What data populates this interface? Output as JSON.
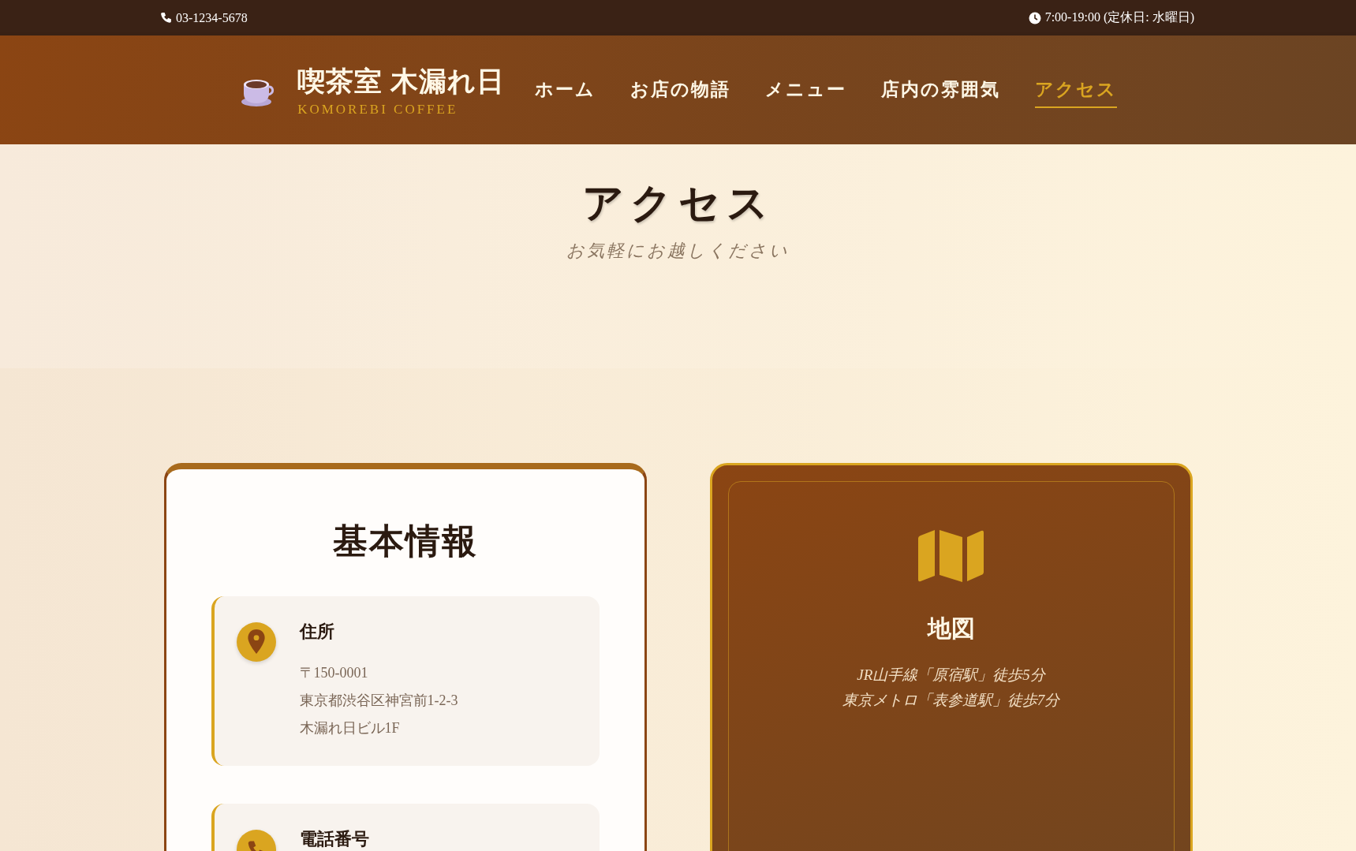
{
  "top_bar": {
    "phone": "03-1234-5678",
    "hours": "7:00-19:00 (定休日: 水曜日)"
  },
  "header": {
    "logo_title": "喫茶室 木漏れ日",
    "logo_subtitle": "KOMOREBI COFFEE",
    "nav": [
      {
        "label": "ホーム",
        "selected": false
      },
      {
        "label": "お店の物語",
        "selected": false
      },
      {
        "label": "メニュー",
        "selected": false
      },
      {
        "label": "店内の雰囲気",
        "selected": false
      },
      {
        "label": "アクセス",
        "selected": true
      }
    ]
  },
  "hero": {
    "title": "アクセス",
    "subtitle": "お気軽にお越しください"
  },
  "info_card": {
    "title": "基本情報",
    "items": [
      {
        "kind": "address",
        "label": "住所",
        "lines": [
          "〒150-0001",
          "東京都渋谷区神宮前1-2-3",
          "木漏れ日ビル1F"
        ]
      },
      {
        "kind": "phone",
        "label": "電話番号"
      }
    ]
  },
  "map_card": {
    "title": "地図",
    "lines": [
      "JR山手線「原宿駅」徒歩5分",
      "東京メトロ「表参道駅」徒歩7分"
    ]
  }
}
